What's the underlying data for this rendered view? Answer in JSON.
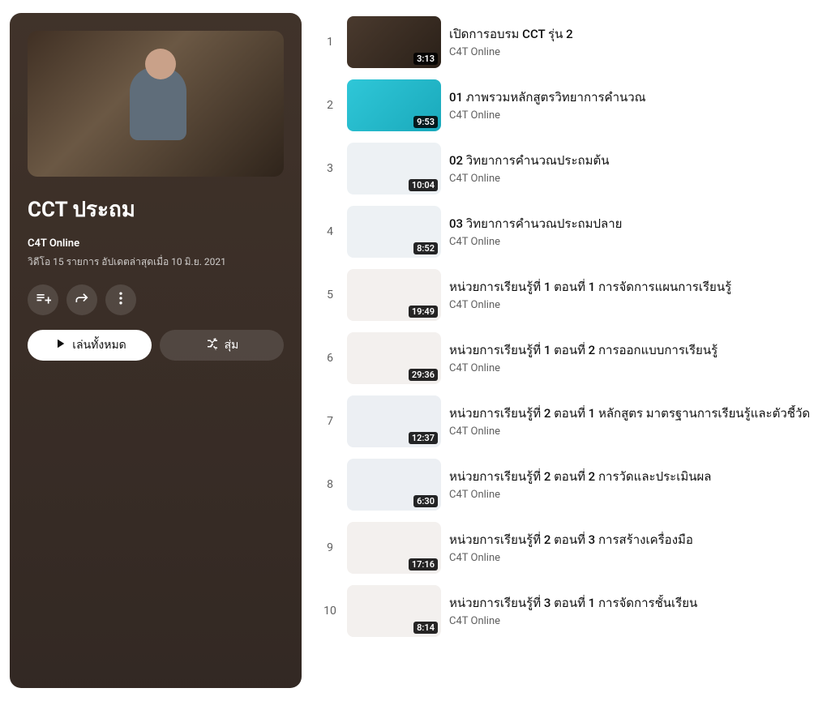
{
  "playlist": {
    "title": "CCT ประถม",
    "owner": "C4T Online",
    "meta": "วิดีโอ 15 รายการ  อัปเดตล่าสุดเมื่อ 10 มิ.ย. 2021",
    "play_all_label": "เล่นทั้งหมด",
    "shuffle_label": "สุ่ม",
    "icons": {
      "save": "playlist-add-icon",
      "share": "share-icon",
      "more": "more-icon"
    }
  },
  "videos": [
    {
      "idx": "1",
      "title": "เปิดการอบรม CCT รุ่น 2",
      "channel": "C4T Online",
      "duration": "3:13",
      "thumb": "dark"
    },
    {
      "idx": "2",
      "title": "01 ภาพรวมหลักสูตรวิทยาการคำนวณ",
      "channel": "C4T Online",
      "duration": "9:53",
      "thumb": "cyan"
    },
    {
      "idx": "3",
      "title": "02 วิทยาการคำนวณประถมต้น",
      "channel": "C4T Online",
      "duration": "10:04",
      "thumb": "plain"
    },
    {
      "idx": "4",
      "title": "03 วิทยาการคำนวณประถมปลาย",
      "channel": "C4T Online",
      "duration": "8:52",
      "thumb": "plain"
    },
    {
      "idx": "5",
      "title": "หน่วยการเรียนรู้ที่ 1 ตอนที่ 1 การจัดการแผนการเรียนรู้",
      "channel": "C4T Online",
      "duration": "19:49",
      "thumb": "plain2"
    },
    {
      "idx": "6",
      "title": "หน่วยการเรียนรู้ที่ 1 ตอนที่ 2 การออกแบบการเรียนรู้",
      "channel": "C4T Online",
      "duration": "29:36",
      "thumb": "plain2"
    },
    {
      "idx": "7",
      "title": "หน่วยการเรียนรู้ที่ 2 ตอนที่ 1 หลักสูตร มาตรฐานการเรียนรู้และตัวชี้วัด",
      "channel": "C4T Online",
      "duration": "12:37",
      "thumb": "plain3"
    },
    {
      "idx": "8",
      "title": "หน่วยการเรียนรู้ที่ 2 ตอนที่ 2 การวัดและประเมินผล",
      "channel": "C4T Online",
      "duration": "6:30",
      "thumb": "plain3"
    },
    {
      "idx": "9",
      "title": "หน่วยการเรียนรู้ที่ 2 ตอนที่ 3 การสร้างเครื่องมือ",
      "channel": "C4T Online",
      "duration": "17:16",
      "thumb": "plain2"
    },
    {
      "idx": "10",
      "title": "หน่วยการเรียนรู้ที่ 3 ตอนที่ 1 การจัดการชั้นเรียน",
      "channel": "C4T Online",
      "duration": "8:14",
      "thumb": "plain2"
    }
  ]
}
